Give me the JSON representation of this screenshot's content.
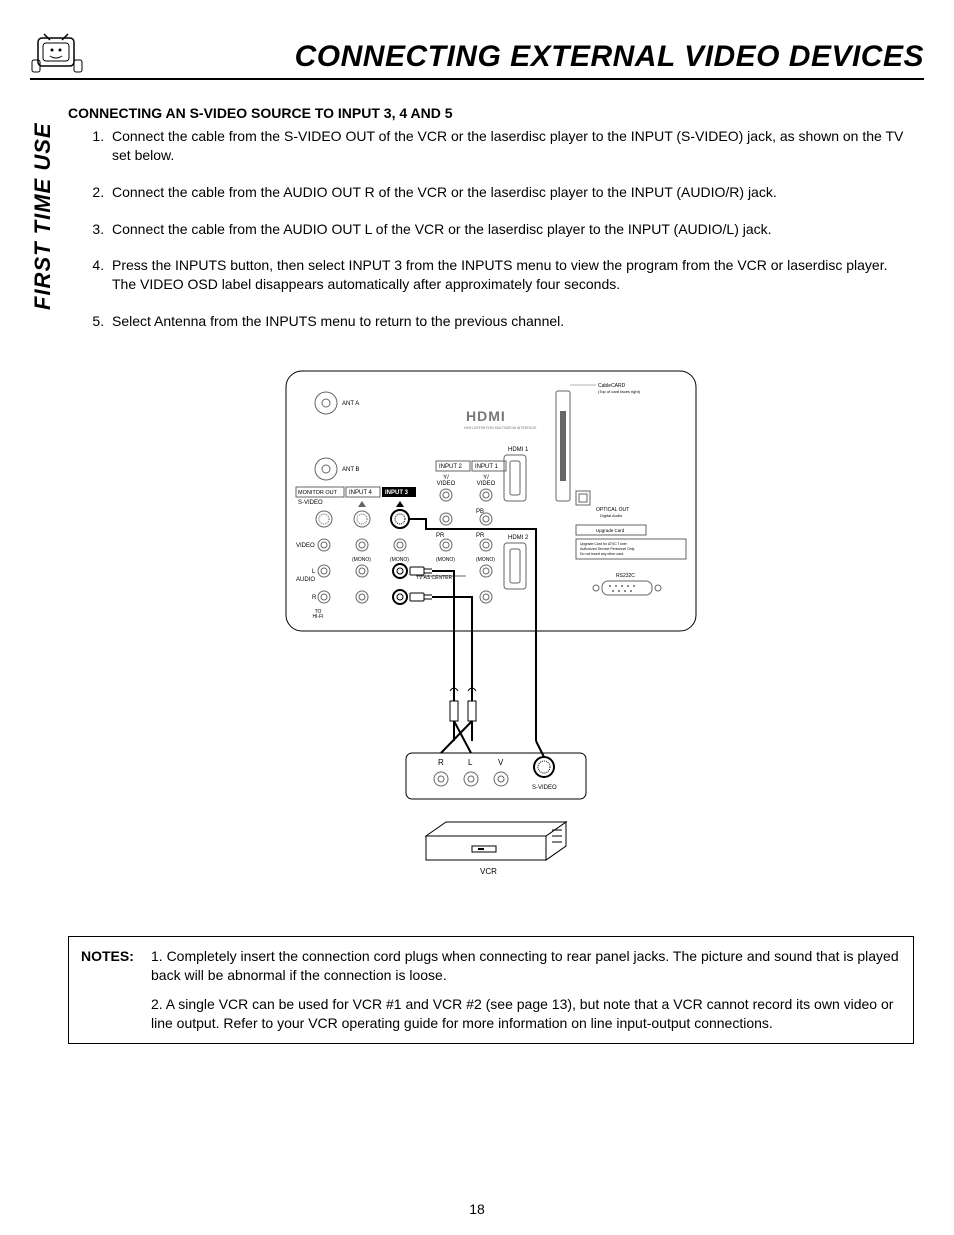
{
  "header": {
    "title": "CONNECTING EXTERNAL VIDEO DEVICES"
  },
  "side_tab": "FIRST TIME USE",
  "section": {
    "heading": "CONNECTING AN S-VIDEO SOURCE TO INPUT 3, 4 AND 5",
    "steps": [
      "Connect the cable from the S-VIDEO OUT of the VCR or the laserdisc player to the INPUT (S-VIDEO) jack, as shown on the TV set below.",
      "Connect the cable from the AUDIO OUT R of the VCR or the laserdisc player to the INPUT (AUDIO/R) jack.",
      "Connect the cable from the AUDIO OUT L of the VCR or the laserdisc player to the INPUT (AUDIO/L) jack.",
      "Press the INPUTS button, then select INPUT 3 from the INPUTS menu to view the program from the VCR or laserdisc player. The VIDEO OSD label disappears automatically after approximately four seconds.",
      "Select Antenna from the INPUTS menu to return to the previous channel."
    ]
  },
  "diagram": {
    "tv_panel": {
      "ant_a": "ANT A",
      "ant_b": "ANT B",
      "hdmi_logo": "HDMI",
      "hdmi_sub": "HIGH-DEFINITION MULTIMEDIA INTERFACE",
      "hdmi1": "HDMI 1",
      "hdmi2": "HDMI 2",
      "input1": "INPUT 1",
      "input2": "INPUT 2",
      "input3": "INPUT 3",
      "input4": "INPUT 4",
      "monitor_out": "MONITOR OUT",
      "svideo": "S-VIDEO",
      "y_video": "Y/\nVIDEO",
      "pb": "PB",
      "pr": "PR",
      "video_row": "VIDEO",
      "mono": "(MONO)",
      "audio": "AUDIO",
      "l": "L",
      "r": "R",
      "tv_as_center": "TV AS CENTER",
      "to_hifi": "TO\nHI-FI",
      "cablecard": "CableCARD\n(Top of card faces right)",
      "optical_out": "OPTICAL OUT\nDigital Audio",
      "upgrade_card": "Upgrade Card",
      "service_note": "Upgrade Card for ATSC Tuner\nAuthorized Service Personnel Only. Do not insert any other card.",
      "rs232c": "RS232C"
    },
    "vcr_panel": {
      "r": "R",
      "l": "L",
      "v": "V",
      "svideo": "S-VIDEO",
      "vcr": "VCR"
    }
  },
  "notes": {
    "label": "NOTES:",
    "items": [
      "1.   Completely insert the connection cord plugs when connecting to rear panel jacks.  The picture and sound that is played back will be abnormal if the connection is loose.",
      "2.   A single VCR can be used for VCR #1 and VCR #2 (see page 13), but note that a VCR cannot record its own video or line output.  Refer to your VCR operating guide for more information on line input-output connections."
    ]
  },
  "page_number": "18"
}
